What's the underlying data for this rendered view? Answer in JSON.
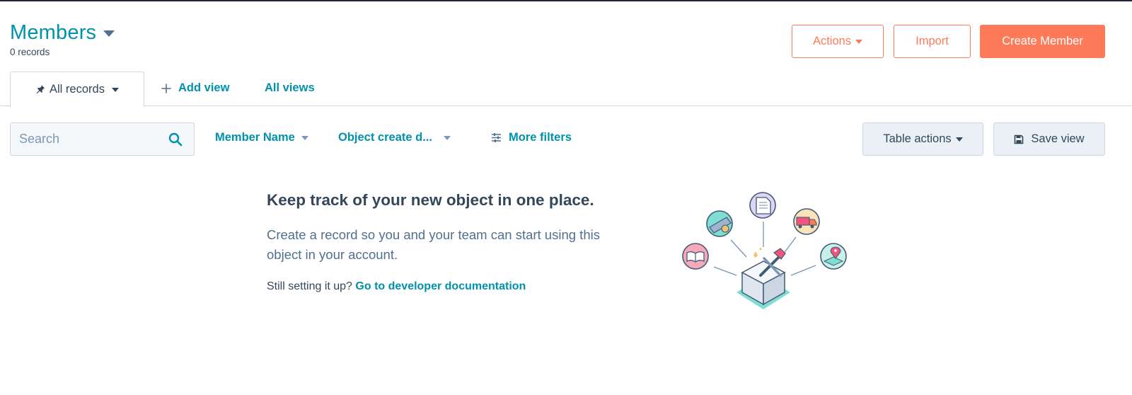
{
  "header": {
    "title": "Members",
    "record_count": "0 records",
    "actions_label": "Actions",
    "import_label": "Import",
    "create_label": "Create Member"
  },
  "tabs": {
    "active_view": "All records",
    "add_view": "Add view",
    "all_views": "All views"
  },
  "toolbar": {
    "search_placeholder": "Search",
    "filters": [
      "Member Name",
      "Object create d..."
    ],
    "more_filters": "More filters",
    "table_actions": "Table actions",
    "save_view": "Save view"
  },
  "empty_state": {
    "heading": "Keep track of your new object in one place.",
    "body": "Create a record so you and your team can start using this object in your account.",
    "footer_prefix": "Still setting it up?",
    "footer_link": "Go to developer documentation"
  },
  "colors": {
    "accent": "#0091ae",
    "brand": "#ff7a59",
    "text": "#33475b"
  }
}
